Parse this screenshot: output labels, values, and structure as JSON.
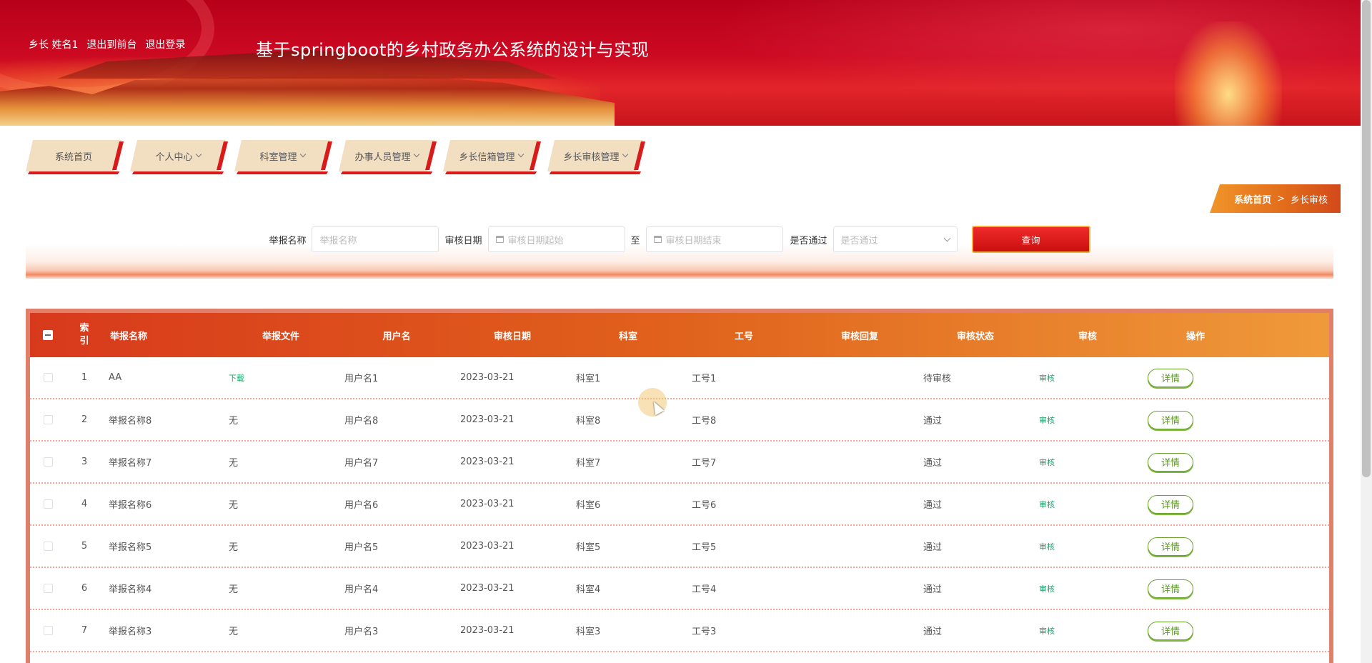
{
  "header": {
    "user_role": "乡长",
    "user_name": "姓名1",
    "back_to_front": "退出到前台",
    "logout": "退出登录",
    "site_title": "基于springboot的乡村政务办公系统的设计与实现"
  },
  "nav": {
    "items": [
      {
        "label": "系统首页",
        "has_dropdown": false
      },
      {
        "label": "个人中心",
        "has_dropdown": true
      },
      {
        "label": "科室管理",
        "has_dropdown": true
      },
      {
        "label": "办事人员管理",
        "has_dropdown": true
      },
      {
        "label": "乡长信箱管理",
        "has_dropdown": true
      },
      {
        "label": "乡长审核管理",
        "has_dropdown": true
      }
    ]
  },
  "breadcrumb": {
    "home": "系统首页",
    "separator": ">",
    "current": "乡长审核"
  },
  "search": {
    "report_name_label": "举报名称",
    "report_name_placeholder": "举报名称",
    "review_date_label": "审核日期",
    "date_start_placeholder": "审核日期起始",
    "date_to": "至",
    "date_end_placeholder": "审核日期结束",
    "passed_label": "是否通过",
    "passed_placeholder": "是否通过",
    "query_button": "查询"
  },
  "table": {
    "headers": {
      "index": "索引",
      "report_name": "举报名称",
      "report_file": "举报文件",
      "username": "用户名",
      "review_date": "审核日期",
      "department": "科室",
      "job_no": "工号",
      "review_reply": "审核回复",
      "review_status": "审核状态",
      "review": "审核",
      "action": "操作"
    },
    "index_header_lines": [
      "索",
      "引"
    ],
    "rows": [
      {
        "index": "1",
        "report_name": "AA",
        "report_file": "下载",
        "username": "用户名1",
        "review_date": "2023-03-21",
        "department": "科室1",
        "job_no": "工号1",
        "review_reply": "",
        "review_status": "待审核",
        "review": "审核",
        "action": "详情"
      },
      {
        "index": "2",
        "report_name": "举报名称8",
        "report_file": "无",
        "username": "用户名8",
        "review_date": "2023-03-21",
        "department": "科室8",
        "job_no": "工号8",
        "review_reply": "",
        "review_status": "通过",
        "review": "审核",
        "action": "详情"
      },
      {
        "index": "3",
        "report_name": "举报名称7",
        "report_file": "无",
        "username": "用户名7",
        "review_date": "2023-03-21",
        "department": "科室7",
        "job_no": "工号7",
        "review_reply": "",
        "review_status": "通过",
        "review": "审核",
        "action": "详情"
      },
      {
        "index": "4",
        "report_name": "举报名称6",
        "report_file": "无",
        "username": "用户名6",
        "review_date": "2023-03-21",
        "department": "科室6",
        "job_no": "工号6",
        "review_reply": "",
        "review_status": "通过",
        "review": "审核",
        "action": "详情"
      },
      {
        "index": "5",
        "report_name": "举报名称5",
        "report_file": "无",
        "username": "用户名5",
        "review_date": "2023-03-21",
        "department": "科室5",
        "job_no": "工号5",
        "review_reply": "",
        "review_status": "通过",
        "review": "审核",
        "action": "详情"
      },
      {
        "index": "6",
        "report_name": "举报名称4",
        "report_file": "无",
        "username": "用户名4",
        "review_date": "2023-03-21",
        "department": "科室4",
        "job_no": "工号4",
        "review_reply": "",
        "review_status": "通过",
        "review": "审核",
        "action": "详情"
      },
      {
        "index": "7",
        "report_name": "举报名称3",
        "report_file": "无",
        "username": "用户名3",
        "review_date": "2023-03-21",
        "department": "科室3",
        "job_no": "工号3",
        "review_reply": "",
        "review_status": "通过",
        "review": "审核",
        "action": "详情"
      }
    ]
  },
  "colors": {
    "brand_red": "#c90f0f",
    "header_orange": "#e0621c",
    "link_green": "#1aa56a",
    "detail_green": "#5a9a20"
  },
  "icons": {
    "calendar": "calendar-icon",
    "dropdown": "chevron-down-icon",
    "cursor": "mouse-cursor-icon"
  }
}
